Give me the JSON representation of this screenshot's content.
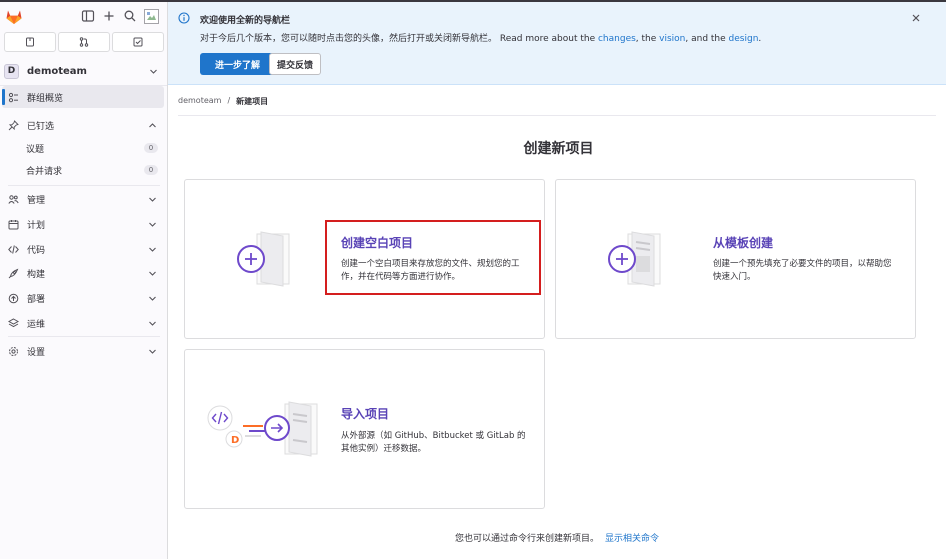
{
  "sidebar": {
    "group": {
      "initial": "D",
      "name": "demoteam"
    },
    "active_item": "群组概览",
    "pinned": {
      "label": "已钉选",
      "items": [
        {
          "label": "议题",
          "count": "0"
        },
        {
          "label": "合并请求",
          "count": "0"
        }
      ]
    },
    "sections": [
      {
        "label": "管理",
        "icon": "users-icon"
      },
      {
        "label": "计划",
        "icon": "calendar-icon"
      },
      {
        "label": "代码",
        "icon": "code-icon"
      },
      {
        "label": "构建",
        "icon": "rocket-icon"
      },
      {
        "label": "部署",
        "icon": "deploy-icon"
      },
      {
        "label": "运维",
        "icon": "monitor-icon"
      }
    ],
    "settings": "设置"
  },
  "banner": {
    "title": "欢迎使用全新的导航栏",
    "text_prefix": "对于今后几个版本，您可以随时点击您的头像，然后打开或关闭新导航栏。 Read more about the ",
    "link_changes": "changes",
    "text_sep1": ", the ",
    "link_vision": "vision",
    "text_sep2": ", and the ",
    "link_design": "design",
    "text_end": ".",
    "primary_button": "进一步了解",
    "secondary_button": "提交反馈"
  },
  "breadcrumb": {
    "group": "demoteam",
    "separator": "/",
    "current": "新建项目"
  },
  "page_title": "创建新项目",
  "cards": {
    "blank": {
      "title": "创建空白项目",
      "desc_line1": "创建一个空白项目来存放您的文件、规划您的工",
      "desc_line2": "作，并在代码等方面进行协作。"
    },
    "template": {
      "title": "从模板创建",
      "desc_line1": "创建一个预先填充了必要文件的项目，以帮助您",
      "desc_line2": "快速入门。"
    },
    "import": {
      "title": "导入项目",
      "desc_line1": "从外部源（如 GitHub、Bitbucket 或 GitLab 的",
      "desc_line2": "其他实例）迁移数据。"
    }
  },
  "footer": {
    "text": "您也可以通过命令行来创建新项目。",
    "link": "显示相关命令"
  },
  "colors": {
    "accent": "#1f75cb",
    "card_title": "#5943b6",
    "highlight": "#d41e1e"
  }
}
